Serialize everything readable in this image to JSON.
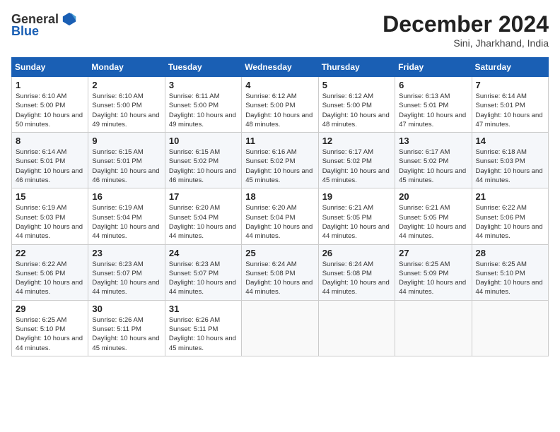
{
  "logo": {
    "general": "General",
    "blue": "Blue"
  },
  "header": {
    "title": "December 2024",
    "subtitle": "Sini, Jharkhand, India"
  },
  "weekdays": [
    "Sunday",
    "Monday",
    "Tuesday",
    "Wednesday",
    "Thursday",
    "Friday",
    "Saturday"
  ],
  "weeks": [
    [
      {
        "day": "1",
        "info": "Sunrise: 6:10 AM\nSunset: 5:00 PM\nDaylight: 10 hours and 50 minutes."
      },
      {
        "day": "2",
        "info": "Sunrise: 6:10 AM\nSunset: 5:00 PM\nDaylight: 10 hours and 49 minutes."
      },
      {
        "day": "3",
        "info": "Sunrise: 6:11 AM\nSunset: 5:00 PM\nDaylight: 10 hours and 49 minutes."
      },
      {
        "day": "4",
        "info": "Sunrise: 6:12 AM\nSunset: 5:00 PM\nDaylight: 10 hours and 48 minutes."
      },
      {
        "day": "5",
        "info": "Sunrise: 6:12 AM\nSunset: 5:00 PM\nDaylight: 10 hours and 48 minutes."
      },
      {
        "day": "6",
        "info": "Sunrise: 6:13 AM\nSunset: 5:01 PM\nDaylight: 10 hours and 47 minutes."
      },
      {
        "day": "7",
        "info": "Sunrise: 6:14 AM\nSunset: 5:01 PM\nDaylight: 10 hours and 47 minutes."
      }
    ],
    [
      {
        "day": "8",
        "info": "Sunrise: 6:14 AM\nSunset: 5:01 PM\nDaylight: 10 hours and 46 minutes."
      },
      {
        "day": "9",
        "info": "Sunrise: 6:15 AM\nSunset: 5:01 PM\nDaylight: 10 hours and 46 minutes."
      },
      {
        "day": "10",
        "info": "Sunrise: 6:15 AM\nSunset: 5:02 PM\nDaylight: 10 hours and 46 minutes."
      },
      {
        "day": "11",
        "info": "Sunrise: 6:16 AM\nSunset: 5:02 PM\nDaylight: 10 hours and 45 minutes."
      },
      {
        "day": "12",
        "info": "Sunrise: 6:17 AM\nSunset: 5:02 PM\nDaylight: 10 hours and 45 minutes."
      },
      {
        "day": "13",
        "info": "Sunrise: 6:17 AM\nSunset: 5:02 PM\nDaylight: 10 hours and 45 minutes."
      },
      {
        "day": "14",
        "info": "Sunrise: 6:18 AM\nSunset: 5:03 PM\nDaylight: 10 hours and 44 minutes."
      }
    ],
    [
      {
        "day": "15",
        "info": "Sunrise: 6:19 AM\nSunset: 5:03 PM\nDaylight: 10 hours and 44 minutes."
      },
      {
        "day": "16",
        "info": "Sunrise: 6:19 AM\nSunset: 5:04 PM\nDaylight: 10 hours and 44 minutes."
      },
      {
        "day": "17",
        "info": "Sunrise: 6:20 AM\nSunset: 5:04 PM\nDaylight: 10 hours and 44 minutes."
      },
      {
        "day": "18",
        "info": "Sunrise: 6:20 AM\nSunset: 5:04 PM\nDaylight: 10 hours and 44 minutes."
      },
      {
        "day": "19",
        "info": "Sunrise: 6:21 AM\nSunset: 5:05 PM\nDaylight: 10 hours and 44 minutes."
      },
      {
        "day": "20",
        "info": "Sunrise: 6:21 AM\nSunset: 5:05 PM\nDaylight: 10 hours and 44 minutes."
      },
      {
        "day": "21",
        "info": "Sunrise: 6:22 AM\nSunset: 5:06 PM\nDaylight: 10 hours and 44 minutes."
      }
    ],
    [
      {
        "day": "22",
        "info": "Sunrise: 6:22 AM\nSunset: 5:06 PM\nDaylight: 10 hours and 44 minutes."
      },
      {
        "day": "23",
        "info": "Sunrise: 6:23 AM\nSunset: 5:07 PM\nDaylight: 10 hours and 44 minutes."
      },
      {
        "day": "24",
        "info": "Sunrise: 6:23 AM\nSunset: 5:07 PM\nDaylight: 10 hours and 44 minutes."
      },
      {
        "day": "25",
        "info": "Sunrise: 6:24 AM\nSunset: 5:08 PM\nDaylight: 10 hours and 44 minutes."
      },
      {
        "day": "26",
        "info": "Sunrise: 6:24 AM\nSunset: 5:08 PM\nDaylight: 10 hours and 44 minutes."
      },
      {
        "day": "27",
        "info": "Sunrise: 6:25 AM\nSunset: 5:09 PM\nDaylight: 10 hours and 44 minutes."
      },
      {
        "day": "28",
        "info": "Sunrise: 6:25 AM\nSunset: 5:10 PM\nDaylight: 10 hours and 44 minutes."
      }
    ],
    [
      {
        "day": "29",
        "info": "Sunrise: 6:25 AM\nSunset: 5:10 PM\nDaylight: 10 hours and 44 minutes."
      },
      {
        "day": "30",
        "info": "Sunrise: 6:26 AM\nSunset: 5:11 PM\nDaylight: 10 hours and 45 minutes."
      },
      {
        "day": "31",
        "info": "Sunrise: 6:26 AM\nSunset: 5:11 PM\nDaylight: 10 hours and 45 minutes."
      },
      {
        "day": "",
        "info": ""
      },
      {
        "day": "",
        "info": ""
      },
      {
        "day": "",
        "info": ""
      },
      {
        "day": "",
        "info": ""
      }
    ]
  ]
}
